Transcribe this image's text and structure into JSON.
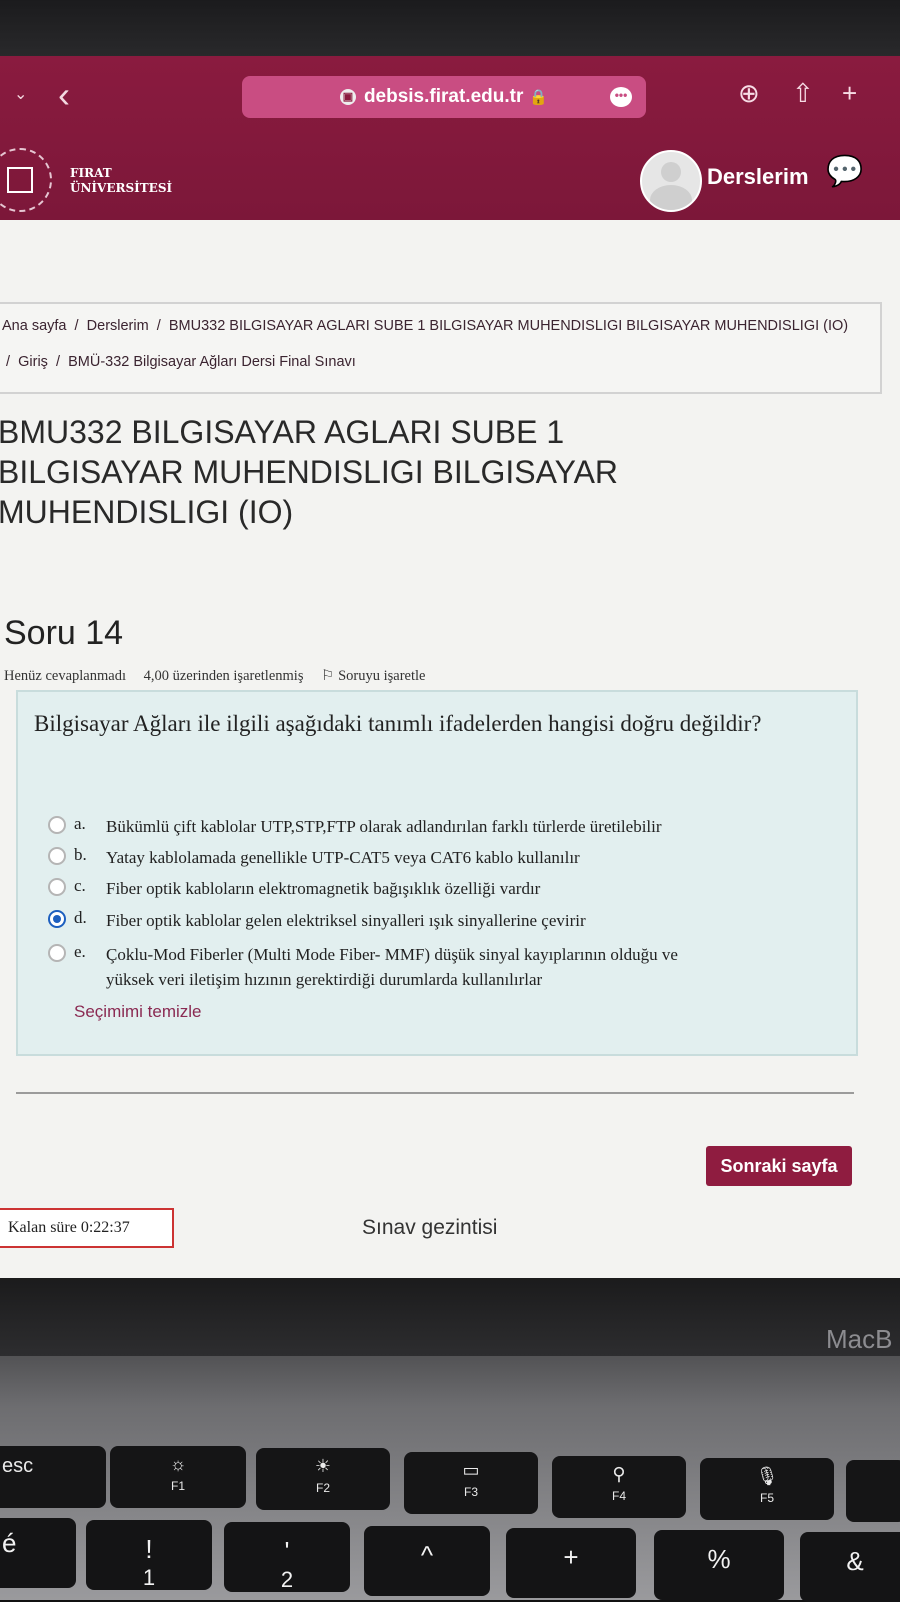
{
  "browser": {
    "url": "debsis.firat.edu.tr"
  },
  "header": {
    "logo_line1": "FIRAT",
    "logo_line2": "ÜNİVERSİTESİ",
    "courses_link": "Derslerim"
  },
  "breadcrumb": {
    "items": [
      "Ana sayfa",
      "Derslerim",
      "BMU332 BILGISAYAR AGLARI SUBE 1 BILGISAYAR MUHENDISLIGI BILGISAYAR MUHENDISLIGI (IO)",
      "Giriş",
      "BMÜ-332 Bilgisayar Ağları Dersi Final Sınavı"
    ]
  },
  "course_title": "BMU332 BILGISAYAR AGLARI SUBE 1 BILGISAYAR MUHENDISLIGI BILGISAYAR MUHENDISLIGI (IO)",
  "question": {
    "title": "Soru 14",
    "status": "Henüz cevaplanmadı",
    "grade": "4,00 üzerinden işaretlenmiş",
    "flag_label": "Soruyu işaretle",
    "text": "Bilgisayar Ağları ile ilgili aşağıdaki tanımlı ifadelerden hangisi doğru değildir?",
    "selected": "d",
    "options": [
      {
        "letter": "a.",
        "text": "Bükümlü çift kablolar UTP,STP,FTP olarak adlandırılan farklı türlerde üretilebilir"
      },
      {
        "letter": "b.",
        "text": "Yatay kablolamada genellikle UTP-CAT5 veya CAT6 kablo kullanılır"
      },
      {
        "letter": "c.",
        "text": "Fiber optik kabloların elektromagnetik bağışıklık özelliği vardır"
      },
      {
        "letter": "d.",
        "text": "Fiber optik kablolar gelen elektriksel sinyalleri ışık sinyallerine çevirir"
      },
      {
        "letter": "e.",
        "text": "Çoklu-Mod Fiberler (Multi Mode Fiber- MMF) düşük sinyal kayıplarının olduğu ve",
        "text2": "yüksek veri iletişim hızının gerektirdiği durumlarda kullanılırlar"
      }
    ],
    "clear_label": "Seçimimi temizle"
  },
  "footer": {
    "next_button": "Sonraki sayfa",
    "timer": "Kalan süre 0:22:37",
    "quiz_nav": "Sınav gezintisi"
  },
  "laptop": {
    "brand_partial": "MacB",
    "keys": {
      "esc": "esc",
      "f1": "F1",
      "f2": "F2",
      "f3": "F3",
      "f4": "F4",
      "f5": "F5",
      "row2": [
        "é",
        "!",
        "'",
        "^",
        "+",
        "%",
        "&"
      ],
      "row2_sub": [
        "1",
        "2"
      ]
    }
  },
  "colors": {
    "brand": "#8a1b3f",
    "url_bar": "#c94d82",
    "question_bg": "#e2efef",
    "radio_selected": "#1d5fbf"
  }
}
